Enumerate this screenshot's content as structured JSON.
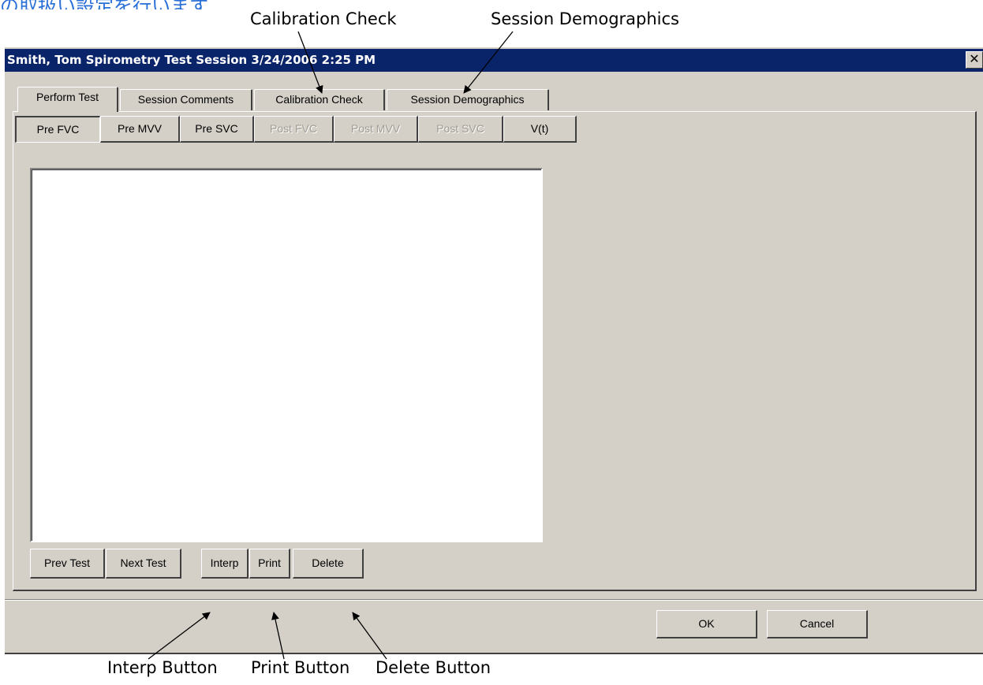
{
  "heading_fragment": "の取扱い設定を行います",
  "callouts": {
    "calibration_check": "Calibration Check",
    "session_demographics": "Session Demographics",
    "interp_button": "Interp Button",
    "print_button": "Print Button",
    "delete_button": "Delete Button"
  },
  "window": {
    "title": "Smith, Tom Spirometry Test Session 3/24/2006 2:25 PM",
    "close_glyph": "✕"
  },
  "tabs": [
    {
      "label": "Perform Test",
      "active": true
    },
    {
      "label": "Session Comments",
      "active": false
    },
    {
      "label": "Calibration Check",
      "active": false
    },
    {
      "label": "Session Demographics",
      "active": false
    }
  ],
  "subtabs": [
    {
      "label": "Pre FVC",
      "state": "selected"
    },
    {
      "label": "Pre MVV",
      "state": "enabled"
    },
    {
      "label": "Pre SVC",
      "state": "enabled"
    },
    {
      "label": "Post FVC",
      "state": "disabled"
    },
    {
      "label": "Post MVV",
      "state": "disabled"
    },
    {
      "label": "Post SVC",
      "state": "disabled"
    },
    {
      "label": "V(t)",
      "state": "enabled"
    }
  ],
  "test_buttons": {
    "prev": "Prev Test",
    "next": "Next Test",
    "interp": "Interp",
    "print": "Print",
    "delete": "Delete"
  },
  "footer": {
    "ok": "OK",
    "cancel": "Cancel"
  },
  "colors": {
    "titlebar": "#0a246a",
    "dialog_face": "#d4d0c8",
    "heading_accent": "#2a6fd8"
  }
}
